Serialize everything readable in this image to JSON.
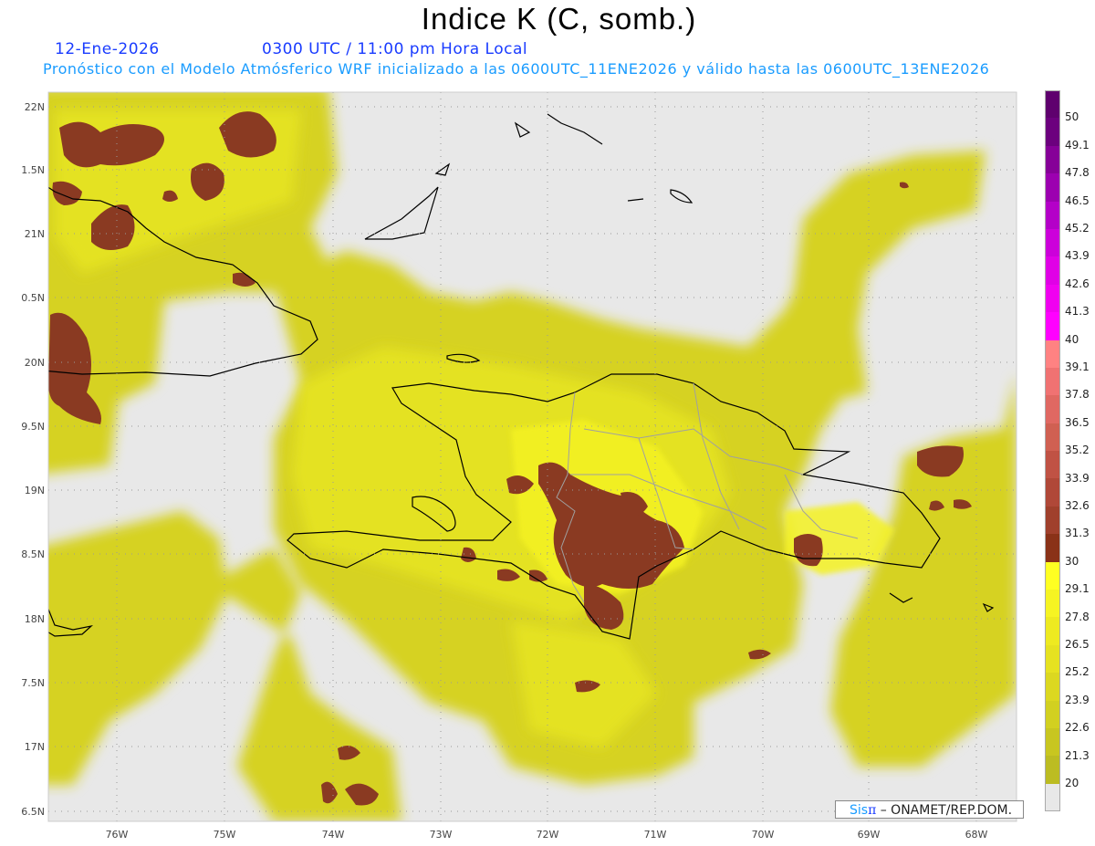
{
  "header": {
    "title": "Indice K (C, somb.)",
    "date": "12-Ene-2026",
    "time": "0300 UTC / 11:00 pm Hora Local",
    "model_info": "Pronóstico con el Modelo Atmósferico WRF inicializado a las 0600UTC_11ENE2026 y válido hasta las  0600UTC_13ENE2026"
  },
  "axes": {
    "lon_labels": [
      "76W",
      "75W",
      "74W",
      "73W",
      "72W",
      "71W",
      "70W",
      "69W",
      "68W"
    ],
    "lat_labels": [
      "22N",
      "1.5N",
      "21N",
      "0.5N",
      "20N",
      "9.5N",
      "19N",
      "8.5N",
      "18N",
      "7.5N",
      "17N",
      "6.5N"
    ]
  },
  "colorbar": {
    "labels": [
      "50",
      "49.1",
      "47.8",
      "46.5",
      "45.2",
      "43.9",
      "42.6",
      "41.3",
      "40",
      "39.1",
      "37.8",
      "36.5",
      "35.2",
      "33.9",
      "32.6",
      "31.3",
      "30",
      "29.1",
      "27.8",
      "26.5",
      "25.2",
      "23.9",
      "22.6",
      "21.3",
      "20"
    ],
    "colors": [
      "#5f006e",
      "#6c007e",
      "#860098",
      "#9c00b0",
      "#b400c8",
      "#cc00da",
      "#e000e6",
      "#f000f0",
      "#ff00ff",
      "#ff8282",
      "#f07272",
      "#e06862",
      "#d06052",
      "#c05244",
      "#b04838",
      "#a0402c",
      "#8a3218",
      "#ffff22",
      "#f6f422",
      "#eeea20",
      "#e6e220",
      "#dcd820",
      "#d2d020",
      "#c8c620",
      "#bcbc22",
      "#e8e8e8"
    ]
  },
  "map_colors": {
    "no_data": "#e8e8e8",
    "low": "#cfcc2a",
    "mid": "#e4e026",
    "high": "#f6f41e",
    "brown": "#8a3a22",
    "coast": "#000000",
    "borders": "#a0a0a0"
  },
  "credit": {
    "brand_sis": "Sis",
    "brand_pi": "π",
    "org": " – ONAMET/REP.DOM."
  }
}
